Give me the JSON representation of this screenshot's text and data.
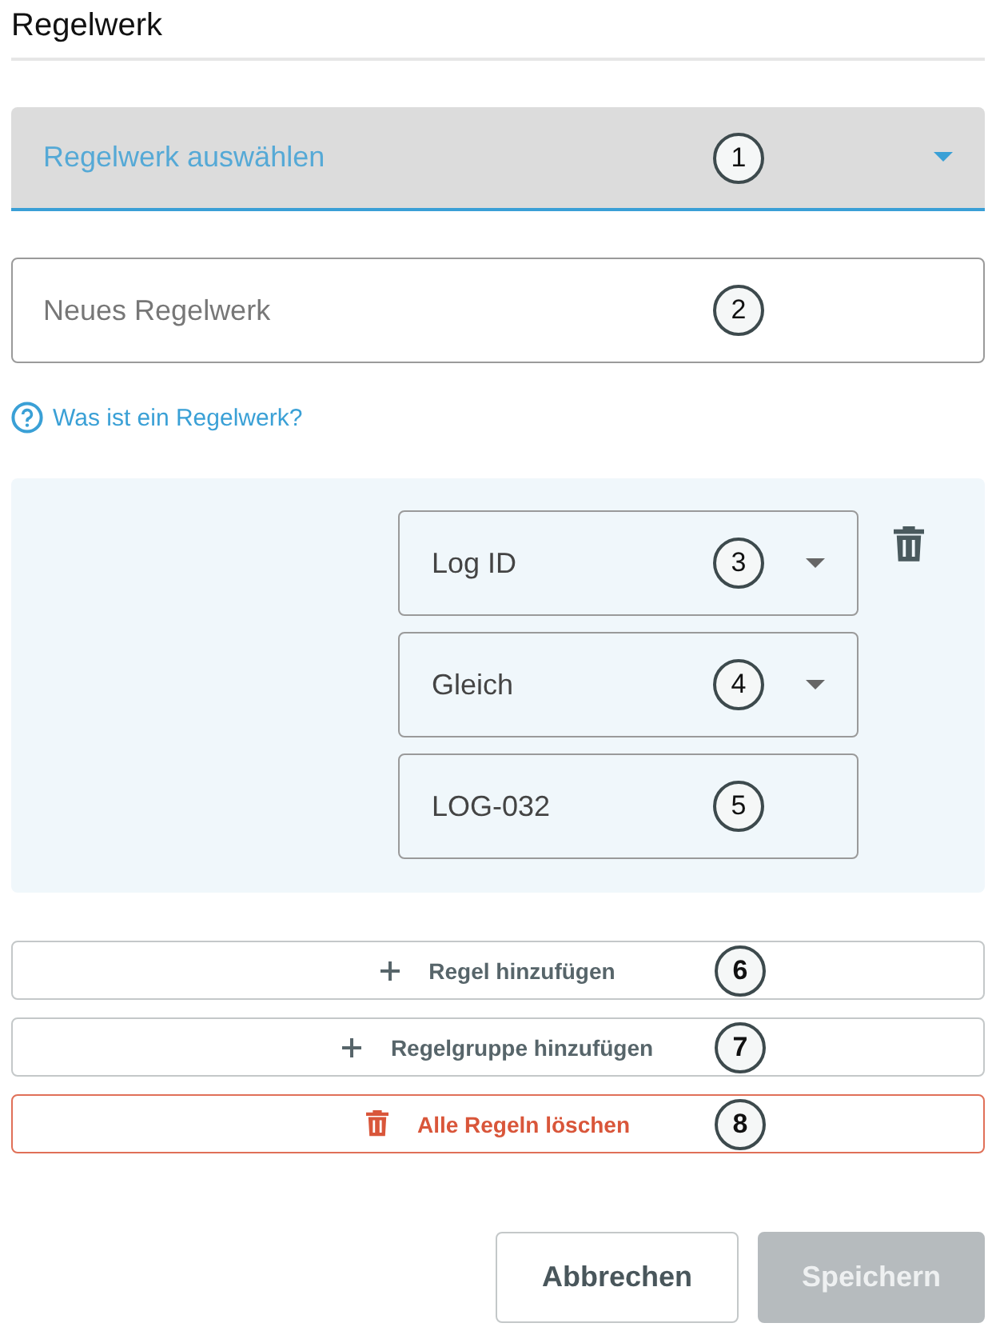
{
  "title": "Regelwerk",
  "ruleset_select": {
    "placeholder": "Regelwerk auswählen",
    "marker": "1"
  },
  "new_ruleset_field": {
    "placeholder": "Neues Regelwerk",
    "marker": "2"
  },
  "help_link": "Was ist ein Regelwerk?",
  "rule": {
    "fields": [
      {
        "kind": "select",
        "value": "Log ID",
        "marker": "3"
      },
      {
        "kind": "select",
        "value": "Gleich",
        "marker": "4"
      },
      {
        "kind": "input",
        "value": "LOG-032",
        "marker": "5"
      }
    ]
  },
  "actions": [
    {
      "kind": "add",
      "label": "Regel hinzufügen",
      "marker": "6"
    },
    {
      "kind": "add",
      "label": "Regelgruppe hinzufügen",
      "marker": "7"
    },
    {
      "kind": "danger",
      "label": "Alle Regeln löschen",
      "marker": "8"
    }
  ],
  "footer": [
    {
      "label": "Abbrechen",
      "disabled": false
    },
    {
      "label": "Speichern",
      "disabled": true
    }
  ]
}
